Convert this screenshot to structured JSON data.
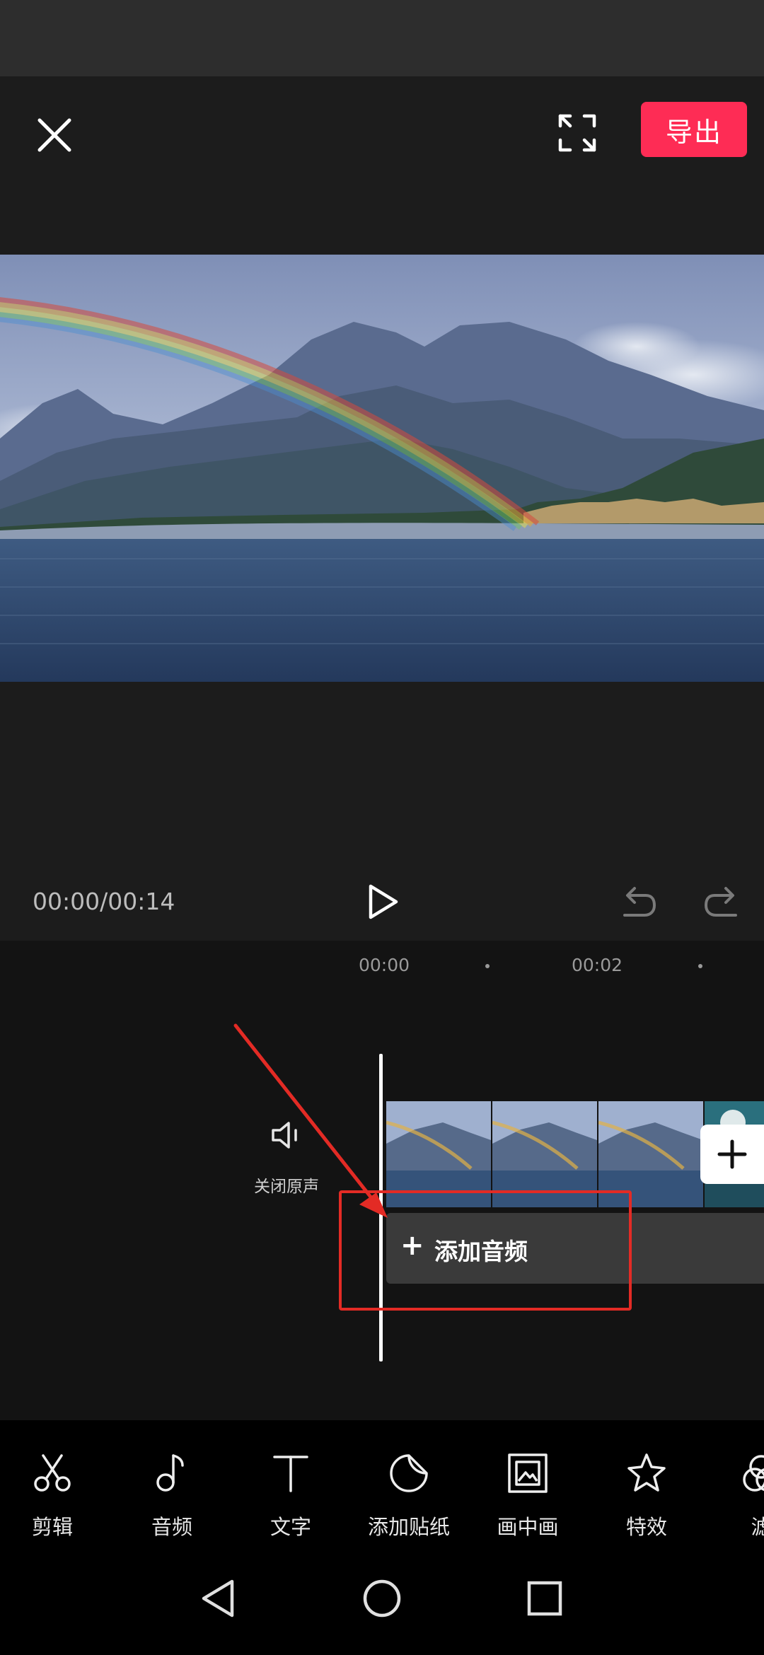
{
  "header": {
    "export_label": "导出"
  },
  "player": {
    "time_readout": "00:00/00:14"
  },
  "timeline": {
    "ruler": [
      "00:00",
      "00:02"
    ],
    "mute_label": "关闭原声",
    "add_audio_label": "添加音频"
  },
  "toolbar": {
    "items": [
      {
        "label": "剪辑",
        "icon": "scissors-icon"
      },
      {
        "label": "音频",
        "icon": "music-note-icon"
      },
      {
        "label": "文字",
        "icon": "text-icon"
      },
      {
        "label": "添加贴纸",
        "icon": "sticker-icon"
      },
      {
        "label": "画中画",
        "icon": "picture-in-picture-icon"
      },
      {
        "label": "特效",
        "icon": "effects-star-icon"
      },
      {
        "label": "滤",
        "icon": "filter-icon"
      }
    ]
  },
  "colors": {
    "accent": "#fe2c55",
    "annotation": "#e32b25"
  }
}
